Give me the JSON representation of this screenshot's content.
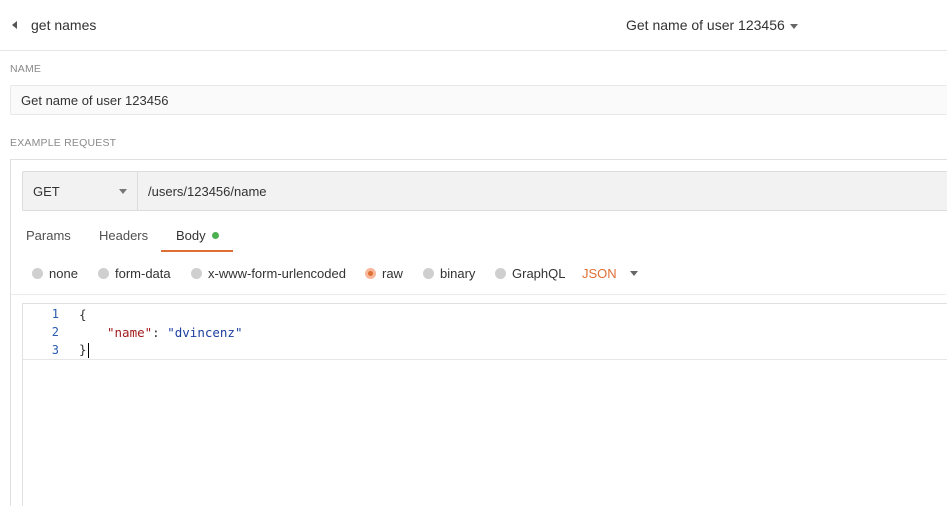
{
  "header": {
    "back_label": "get names",
    "example_name": "Get name of user 123456"
  },
  "name_section": {
    "label": "NAME",
    "value": "Get name of user 123456"
  },
  "request_section": {
    "label": "EXAMPLE REQUEST",
    "method": "GET",
    "url": "/users/123456/name",
    "tabs": [
      {
        "label": "Params"
      },
      {
        "label": "Headers"
      },
      {
        "label": "Body",
        "active": true,
        "indicator": "green-dot"
      }
    ],
    "body_types": [
      {
        "label": "none"
      },
      {
        "label": "form-data"
      },
      {
        "label": "x-www-form-urlencoded"
      },
      {
        "label": "raw",
        "selected": true
      },
      {
        "label": "binary"
      },
      {
        "label": "GraphQL"
      }
    ],
    "language": "JSON",
    "code": {
      "line_numbers": [
        "1",
        "2",
        "3"
      ],
      "line1": "{",
      "line2_key": "\"name\"",
      "line2_sep": ": ",
      "line2_value": "\"dvincenz\"",
      "line3": "}"
    }
  },
  "colors": {
    "accent": "#e06f35",
    "active_dot": "#4caf50",
    "json_key": "#a11d1d",
    "json_string": "#1c3f9f"
  },
  "icons": {
    "back": "caret-left-icon",
    "dropdown": "caret-down-icon"
  }
}
